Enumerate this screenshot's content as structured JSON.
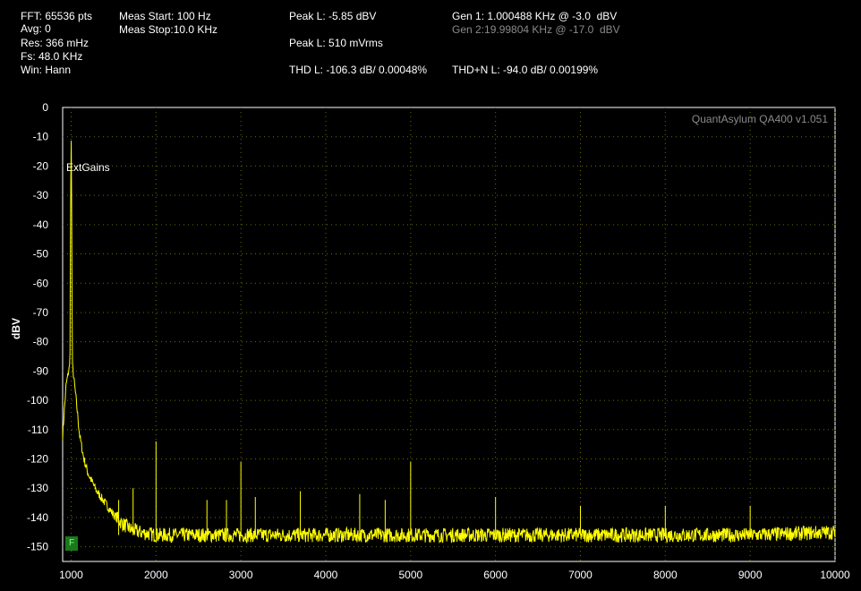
{
  "header": {
    "fft": "FFT: 65536 pts",
    "avg": "Avg: 0",
    "res": "Res: 366 mHz",
    "fs": "Fs: 48.0 KHz",
    "win": "Win: Hann",
    "meas_start": "Meas Start: 100 Hz",
    "meas_stop": "Meas Stop:10.0 KHz",
    "peak_dbv": "Peak L: -5.85 dBV",
    "peak_vrms": "Peak L: 510 mVrms",
    "thd": "THD L: -106.3 dB/ 0.00048%",
    "thdn": "THD+N L: -94.0 dB/ 0.00199%",
    "gen1": "Gen 1: 1.000488 KHz @ -3.0  dBV",
    "gen2": "Gen 2:19.99804 KHz @ -17.0  dBV"
  },
  "watermark": "QuantAsylum QA400 v1.051",
  "ext_gains": "ExtGains",
  "marker_label": "F",
  "colors": {
    "trace": "#ffff00",
    "grid": "#6b6b00",
    "background": "#000000",
    "frame": "#ffffff"
  },
  "chart_data": {
    "type": "line",
    "xlabel": "",
    "ylabel": "dBV",
    "xlim": [
      900,
      10000
    ],
    "ylim": [
      -155,
      0
    ],
    "xticks": [
      1000,
      2000,
      3000,
      4000,
      5000,
      6000,
      7000,
      8000,
      9000,
      10000
    ],
    "yticks": [
      0,
      -10,
      -20,
      -30,
      -40,
      -50,
      -60,
      -70,
      -80,
      -90,
      -100,
      -110,
      -120,
      -130,
      -140,
      -150
    ],
    "grid": true,
    "noise_floor_dbv": -146,
    "series": [
      {
        "x": [
          900,
          940,
          970,
          985,
          995,
          1000,
          1005,
          1015,
          1030,
          1060,
          1100,
          1150,
          1200,
          1300,
          1400,
          1500,
          1600,
          1700,
          1800,
          2000,
          2500,
          3000,
          4000,
          5000,
          6000,
          7000,
          8000,
          9000,
          10000
        ],
        "y": [
          -112,
          -95,
          -90,
          -88,
          -30,
          -6,
          -30,
          -88,
          -92,
          -100,
          -112,
          -120,
          -125,
          -131,
          -135,
          -139,
          -142,
          -144,
          -145,
          -146,
          -146,
          -146,
          -146,
          -146,
          -146,
          -146,
          -146,
          -146,
          -145
        ],
        "spurs": [
          {
            "x": 2000,
            "y": -114
          },
          {
            "x": 3000,
            "y": -121
          },
          {
            "x": 5000,
            "y": -121
          },
          {
            "x": 1560,
            "y": -134
          },
          {
            "x": 1730,
            "y": -130
          },
          {
            "x": 2600,
            "y": -134
          },
          {
            "x": 2830,
            "y": -134
          },
          {
            "x": 3170,
            "y": -133
          },
          {
            "x": 3700,
            "y": -131
          },
          {
            "x": 4400,
            "y": -132
          },
          {
            "x": 4700,
            "y": -134
          },
          {
            "x": 6000,
            "y": -133
          },
          {
            "x": 7000,
            "y": -136
          },
          {
            "x": 8000,
            "y": -136
          },
          {
            "x": 9000,
            "y": -136
          }
        ]
      }
    ]
  }
}
